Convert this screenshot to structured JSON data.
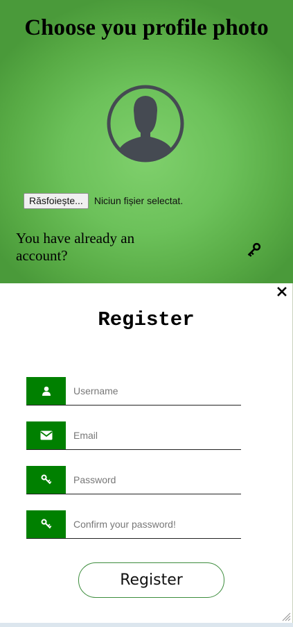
{
  "photo_section": {
    "title": "Choose you profile photo",
    "browse_button": "Răsfoiește...",
    "file_status": "Niciun fișier selectat.",
    "have_account_text": "You have already an account?",
    "avatar_icon": "user-silhouette-icon",
    "login_icon": "key-icon"
  },
  "register_form": {
    "title": "Register",
    "close_icon": "close-icon",
    "fields": [
      {
        "placeholder": "Username",
        "icon": "user-icon"
      },
      {
        "placeholder": "Email",
        "icon": "envelope-icon"
      },
      {
        "placeholder": "Password",
        "icon": "key-icon"
      },
      {
        "placeholder": "Confirm your password!",
        "icon": "key-icon"
      }
    ],
    "submit_label": "Register"
  },
  "colors": {
    "accent_green": "#008000",
    "header_green": "#6cc15a",
    "avatar_gray": "#454a52"
  }
}
